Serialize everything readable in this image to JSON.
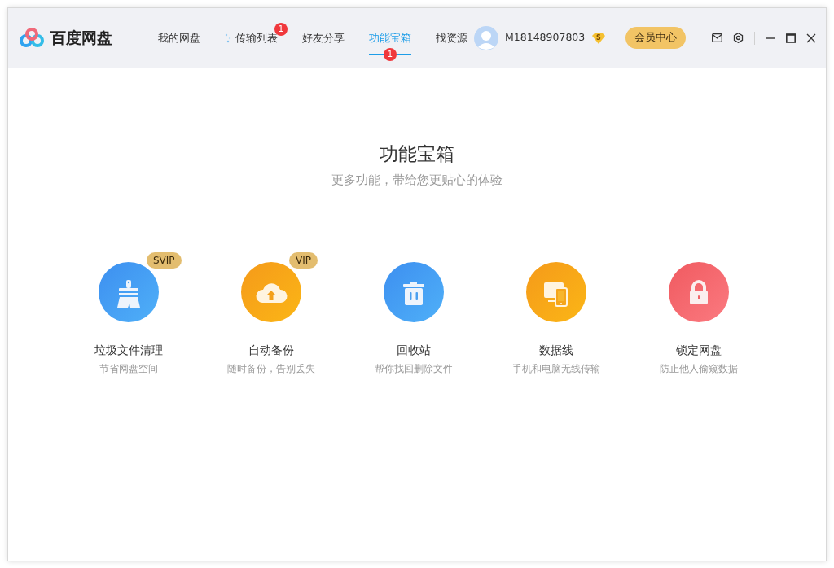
{
  "app": {
    "name": "百度网盘"
  },
  "tabs": [
    {
      "label": "我的网盘",
      "selected": false,
      "kind": "plain"
    },
    {
      "label": "传输列表",
      "selected": false,
      "badge": "1",
      "kind": "sparkle"
    },
    {
      "label": "好友分享",
      "selected": false,
      "kind": "plain"
    },
    {
      "label": "功能宝箱",
      "selected": true,
      "badge": "1",
      "kind": "plain"
    },
    {
      "label": "找资源",
      "selected": false,
      "kind": "plain"
    }
  ],
  "user": {
    "name": "M18148907803",
    "level_badge": "S"
  },
  "vip_button": "会员中心",
  "page": {
    "title": "功能宝箱",
    "subtitle": "更多功能，带给您更贴心的体验"
  },
  "tools": [
    {
      "kind": "broom",
      "name": "垃圾文件清理",
      "desc": "节省网盘空间",
      "tag": "SVIP"
    },
    {
      "kind": "cloud-upload",
      "name": "自动备份",
      "desc": "随时备份，告别丢失",
      "tag": "VIP"
    },
    {
      "kind": "trash",
      "name": "回收站",
      "desc": "帮你找回删除文件"
    },
    {
      "kind": "devices",
      "name": "数据线",
      "desc": "手机和电脑无线传输"
    },
    {
      "kind": "lock",
      "name": "锁定网盘",
      "desc": "防止他人偷窥数据"
    }
  ]
}
